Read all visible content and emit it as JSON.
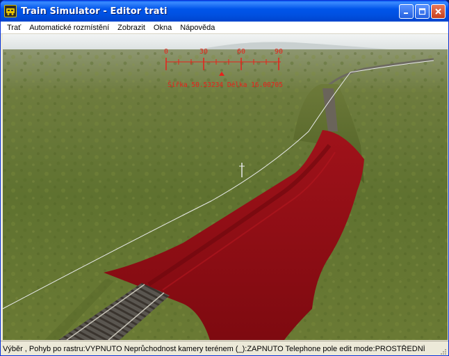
{
  "window": {
    "title": "Train Simulator - Editor trati",
    "icon": "train-app-icon"
  },
  "menu": {
    "items": [
      {
        "label": "Trať"
      },
      {
        "label": "Automatické rozmístění"
      },
      {
        "label": "Zobrazit"
      },
      {
        "label": "Okna"
      },
      {
        "label": "Nápověda"
      }
    ]
  },
  "compass": {
    "ticks": [
      "0",
      "30",
      "60",
      "90"
    ],
    "coords": "Šířka 50.53234 Délka 16.00705"
  },
  "status": {
    "text": "Výběr , Pohyb po rastru:VYPNUTO Neprůchodnost kamery terénem (_):ZAPNUTO Telephone pole edit mode:PROSTŘEDNÍ"
  },
  "colors": {
    "hud": "#e8201a",
    "selection": "#8b0b0f",
    "grass": "#6e7a34"
  }
}
